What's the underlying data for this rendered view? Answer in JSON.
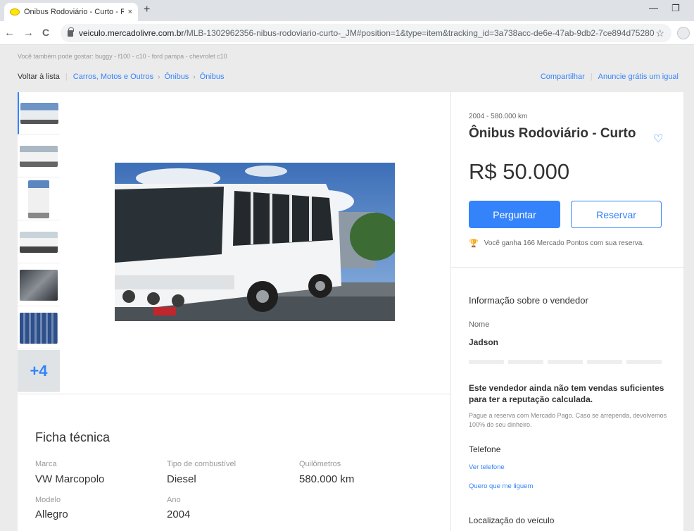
{
  "browser": {
    "tab_title": "Ônibus Rodoviário - Curto - R$ 5",
    "tab_close": "×",
    "new_tab": "+",
    "url_host": "veiculo.mercadolivre.com.br",
    "url_path": "/MLB-1302962356-nibus-rodoviario-curto-_JM#position=1&type=item&tracking_id=3a738acc-de6e-47ab-9db2-7ce894d75280",
    "star": "☆",
    "back": "←",
    "forward": "→",
    "reload": "C",
    "minimize": "—",
    "restore": "❐"
  },
  "suggestion": "Você também pode gostar: buggy - f100 - c10 - ford pampa - chevrolet c10",
  "breadcrumb": {
    "back": "Voltar à lista",
    "items": [
      "Carros, Motos e Outros",
      "Ônibus",
      "Ônibus"
    ],
    "separator": "›"
  },
  "actions": {
    "share": "Compartilhar",
    "advertise": "Anuncie grátis um igual"
  },
  "gallery": {
    "more": "+4"
  },
  "listing": {
    "subtitle": "2004 - 580.000 km",
    "title": "Ônibus Rodoviário - Curto",
    "price": "R$ 50.000",
    "ask_button": "Perguntar",
    "reserve_button": "Reservar",
    "points": "Você ganha 166 Mercado Pontos com sua reserva."
  },
  "seller": {
    "section_title": "Informação sobre o vendedor",
    "name_label": "Nome",
    "name": "Jadson",
    "reputation": "Este vendedor ainda não tem vendas suficientes para ter a reputação calculada.",
    "payment": "Pague a reserva com Mercado Pago. Caso se arrependa, devolvemos 100% do seu dinheiro.",
    "phone_label": "Telefone",
    "see_phone": "Ver telefone",
    "call_me": "Quero que me liguem",
    "location_label": "Localização do veículo"
  },
  "specs": {
    "title": "Ficha técnica",
    "marca_label": "Marca",
    "marca": "VW Marcopolo",
    "combustivel_label": "Tipo de combustível",
    "combustivel": "Diesel",
    "km_label": "Quilômetros",
    "km": "580.000 km",
    "modelo_label": "Modelo",
    "modelo": "Allegro",
    "ano_label": "Ano",
    "ano": "2004"
  }
}
